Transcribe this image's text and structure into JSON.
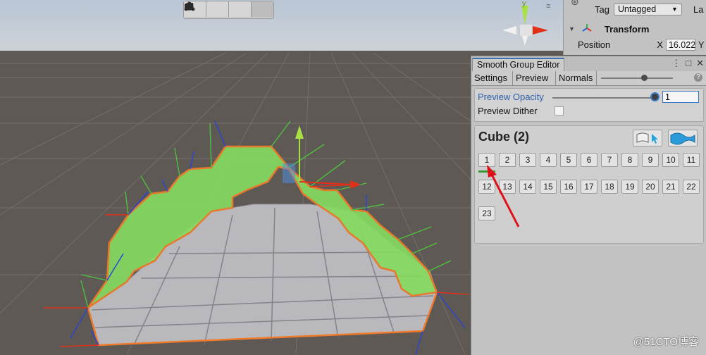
{
  "scene": {
    "toolbar_icons": [
      "shaded-cube-icon",
      "vertex-mode-icon",
      "edge-mode-icon",
      "face-mode-icon"
    ]
  },
  "inspector": {
    "tag_label": "Tag",
    "tag_value": "Untagged",
    "layer_label": "La",
    "transform_label": "Transform",
    "position_label": "Position",
    "x_label": "X",
    "x_value": "16.022",
    "y_label": "Y"
  },
  "editor": {
    "title": "Smooth Group Editor",
    "tabs": [
      "Settings",
      "Preview",
      "Normals"
    ],
    "preview_opacity_label": "Preview Opacity",
    "preview_opacity_value": "1",
    "preview_dither_label": "Preview Dither",
    "object_name": "Cube (2)",
    "groups": [
      "1",
      "2",
      "3",
      "4",
      "5",
      "6",
      "7",
      "8",
      "9",
      "10",
      "11",
      "12",
      "13",
      "14",
      "15",
      "16",
      "17",
      "18",
      "19",
      "20",
      "21",
      "22",
      "23"
    ]
  },
  "watermark": "@51CTO博客",
  "colors": {
    "accent": "#3a72b0",
    "selection_green": "#7ed957",
    "edge_orange": "#f07a20",
    "annotation_red": "#e0101a"
  }
}
